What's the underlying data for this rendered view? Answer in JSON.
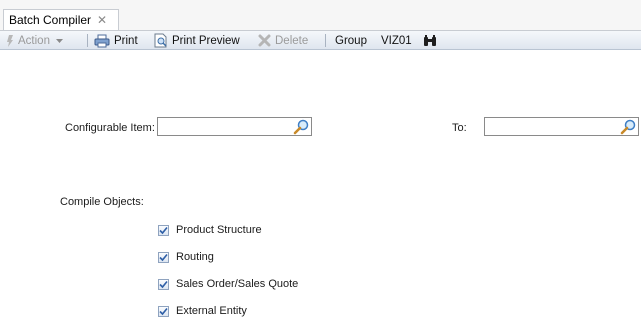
{
  "tab": {
    "title": "Batch Compiler",
    "close_glyph": "✕"
  },
  "toolbar": {
    "action_label": "Action",
    "print_label": "Print",
    "print_preview_label": "Print Preview",
    "delete_label": "Delete",
    "group_label": "Group",
    "group_value": "VIZ01"
  },
  "form": {
    "configurable_item_label": "Configurable Item:",
    "configurable_item_value": "",
    "to_label": "To:",
    "to_value": "",
    "compile_objects_label": "Compile Objects:",
    "options": [
      {
        "label": "Product Structure",
        "checked": true
      },
      {
        "label": "Routing",
        "checked": true
      },
      {
        "label": "Sales Order/Sales Quote",
        "checked": true
      },
      {
        "label": "External Entity",
        "checked": true
      }
    ]
  },
  "colors": {
    "check_mark": "#2f5fa7",
    "lookup_lens": "#4a8fd6"
  },
  "icons": [
    "action-icon",
    "dropdown-arrow-icon",
    "printer-icon",
    "print-preview-icon",
    "delete-icon",
    "binoculars-icon",
    "magnifier-icon",
    "checkmark-icon"
  ]
}
